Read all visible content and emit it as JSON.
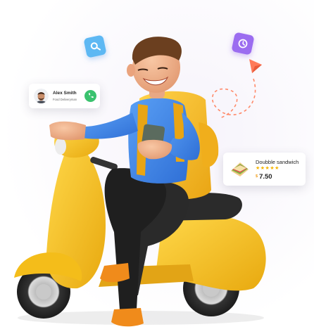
{
  "driver_card": {
    "name": "Alex Smith",
    "role": "Food Deliveryman",
    "avatar_icon": "avatar",
    "call_icon": "phone-icon",
    "call_color": "#3ac26e"
  },
  "food_card": {
    "title": "Doubble sandwich",
    "rating_stars": "★★★★★",
    "currency": "$",
    "price": "7.50",
    "star_color": "#f5b400",
    "thumb_icon": "sandwich-icon"
  },
  "decorations": {
    "search_bubble_icon": "search-icon",
    "search_bubble_color": "#5db8f3",
    "clock_bubble_icon": "clock-icon",
    "clock_bubble_color": "#9b6cf0",
    "paper_plane_icon": "paper-plane-icon",
    "accent": "#ff7a59"
  },
  "illustration": {
    "subject": "delivery-man-on-scooter",
    "scooter_color": "#f6c21b",
    "shirt_color": "#3f86e8",
    "backpack_color": "#f4b81f"
  }
}
